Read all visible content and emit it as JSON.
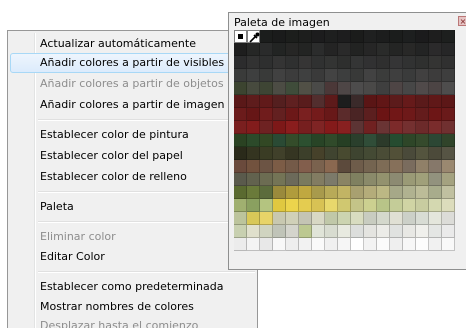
{
  "palette_window": {
    "title": "Paleta de imagen",
    "colors": [
      [
        "tool-pixel",
        "tool-eyedropper",
        "#1b1d1c",
        "#1a1b1b",
        "#1c1e1c",
        "#1d1e1d",
        "#1c1c1d",
        "#1e1f1f",
        "#1d1d1e",
        "#1b1c1b",
        "#1f2020",
        "#1c1d1d",
        "#1b1d1c",
        "#1d1f1f",
        "#1b1b1c",
        "#1e1e1e",
        "#1d1f1e"
      ],
      [
        "#1e1e1e",
        "#262726",
        "#2a2b2b",
        "#222423",
        "#262625",
        "#232423",
        "#2b2c2c",
        "#242424",
        "#2a2a2a",
        "#222322",
        "#262626",
        "#2a2b2a",
        "#242524",
        "#282827",
        "#232424",
        "#2b2a2b",
        "#262627"
      ],
      [
        "#2c2c2d",
        "#323232",
        "#2e2f2f",
        "#343434",
        "#2f3030",
        "#363535",
        "#303131",
        "#333433",
        "#2e2f2e",
        "#343535",
        "#313132",
        "#2f2f2f",
        "#353536",
        "#313232",
        "#2f302f",
        "#343433",
        "#303030"
      ],
      [
        "#3a3b3a",
        "#3e3f3f",
        "#393a39",
        "#414141",
        "#3c3c3c",
        "#3f4040",
        "#3a3a3a",
        "#434343",
        "#3d3e3e",
        "#383938",
        "#424242",
        "#3b3c3b",
        "#3f3f3f",
        "#3a3b3b",
        "#414040",
        "#3d3c3c",
        "#3e3e3e"
      ],
      [
        "#3c4430",
        "#474a3e",
        "#3e4534",
        "#4c4c44",
        "#3f4c3a",
        "#515046",
        "#4a4a48",
        "#4b3838",
        "#4e4646",
        "#4d4c4c",
        "#4a4948",
        "#3f3f3f",
        "#4e4545",
        "#474747",
        "#504a4a",
        "#4c4444",
        "#4e4d4d"
      ],
      [
        "#5a1818",
        "#5e1c1c",
        "#611a1a",
        "#541f1f",
        "#5f2020",
        "#591c1c",
        "#522e2e",
        "#5d1a1a",
        "#1d1d1d",
        "#3a2a2a",
        "#5a1515",
        "#611616",
        "#5c1b1b",
        "#661a1a",
        "#5a1a1a",
        "#601818",
        "#5c1717"
      ],
      [
        "#6b1b1b",
        "#661616",
        "#701c1c",
        "#632020",
        "#6c1818",
        "#7a2020",
        "#741b1b",
        "#681818",
        "#5b2b2b",
        "#4a2424",
        "#5c1f1f",
        "#6b1414",
        "#711717",
        "#6e1919",
        "#641c1c",
        "#6d1616",
        "#6a1a1a"
      ],
      [
        "#7a1f1f",
        "#821c1c",
        "#6e2222",
        "#7d1818",
        "#8a1d1d",
        "#761f1f",
        "#7f2424",
        "#841a1a",
        "#882020",
        "#5c3434",
        "#702121",
        "#6a3434",
        "#7c2a2a",
        "#743030",
        "#6c2a2a",
        "#7a2c2c",
        "#703030"
      ],
      [
        "#2a4222",
        "#2c4a2a",
        "#324824",
        "#2a4a34",
        "#344c2a",
        "#2c5030",
        "#284426",
        "#304a2a",
        "#263f24",
        "#2a3f2c",
        "#304d38",
        "#2c3a2a",
        "#264c30",
        "#2e4628",
        "#354a2c",
        "#2c4734",
        "#30442a"
      ],
      [
        "#2a2a1a",
        "#343420",
        "#3a3c24",
        "#40402a",
        "#353522",
        "#3c3f2a",
        "#46412a",
        "#404430",
        "#484a30",
        "#3e4430",
        "#444a34",
        "#4a4c36",
        "#525038",
        "#4a4a3a",
        "#54543e",
        "#4c4a3a",
        "#565444"
      ],
      [
        "#6a4a3c",
        "#72523e",
        "#6c5444",
        "#7c5c46",
        "#745a48",
        "#825e4c",
        "#7a624e",
        "#8a6850",
        "#5c4a3c",
        "#6e5c4a",
        "#746450",
        "#7e6c56",
        "#86705a",
        "#7a6c5e",
        "#908068",
        "#86786a",
        "#9a8870"
      ],
      [
        "#5a5a4c",
        "#62624e",
        "#6c6c52",
        "#747456",
        "#6c6a5a",
        "#7a7a5e",
        "#827c62",
        "#7c7a6a",
        "#8a8464",
        "#7f8060",
        "#8a8a6a",
        "#93926e",
        "#8c8a72",
        "#9a9a76",
        "#a0a07a",
        "#92927e",
        "#a4a280"
      ],
      [
        "#5a6a30",
        "#6a7a3a",
        "#5c6c3c",
        "#9a8a3c",
        "#b09c3c",
        "#c0a840",
        "#a89a4c",
        "#b8aa58",
        "#c2b464",
        "#a8a070",
        "#b4ac7a",
        "#bcb884",
        "#a6a888",
        "#b0b290",
        "#bcbc98",
        "#a8ac8c",
        "#c0c0a0"
      ],
      [
        "#a0b070",
        "#8aa060",
        "#b4c480",
        "#e0c840",
        "#ecd44c",
        "#e4cc50",
        "#d8c254",
        "#e8d86c",
        "#d0c870",
        "#c4c488",
        "#ccd090",
        "#b8c488",
        "#c4cc98",
        "#d0d4a4",
        "#c8cca0",
        "#d4d8b0",
        "#dcdcbc"
      ],
      [
        "#bcc49c",
        "#d8c858",
        "#e8d468",
        "#c8c8b0",
        "#d0d0b8",
        "#c4c4b4",
        "#d8d8c4",
        "#c0c8a8",
        "#ccd4b0",
        "#d8dcc0",
        "#c8ccc0",
        "#d4d8cc",
        "#e0e0d4",
        "#ccd0c8",
        "#d8dcd4",
        "#e4e6dc",
        "#dcdcd8"
      ],
      [
        "#c8d0b0",
        "#e0e0cc",
        "#d0d4c0",
        "#c0c4b8",
        "#d4d4cc",
        "#bcc890",
        "#e0e4d8",
        "#d8dcd0",
        "#e8eae0",
        "#dcdedc",
        "#e4e4e0",
        "#ecece8",
        "#e0e2e0",
        "#e8e8e4",
        "#f0f0ec",
        "#e4e6e4",
        "#eaeaea"
      ],
      [
        "#ececec",
        "#f4f4f4",
        "#e8e8e8",
        "#f8f8f8",
        "#eeeeee",
        "#f2f2f2",
        "#fafafa",
        "#f0f0f0",
        "#f6f6f6",
        "#ffffff",
        "#f3f3f3",
        "#fbfbfb",
        "#efefef",
        "#f7f7f7",
        "#fdfdfd",
        "#f1f1f1",
        "#f9f9f9"
      ]
    ]
  },
  "context_menu": {
    "items": [
      {
        "label": "Actualizar automáticamente",
        "disabled": false
      },
      {
        "label": "Añadir colores a partir de visibles",
        "disabled": false,
        "hover": true
      },
      {
        "label": "Añadir colores a partir de objetos",
        "disabled": true
      },
      {
        "label": "Añadir colores a partir de imagen",
        "disabled": false
      },
      {
        "label": "Establecer color de pintura",
        "disabled": false
      },
      {
        "label": "Establecer color del papel",
        "disabled": false
      },
      {
        "label": "Establecer color de relleno",
        "disabled": false
      },
      {
        "label": "Paleta",
        "disabled": false
      },
      {
        "label": "Eliminar color",
        "disabled": true
      },
      {
        "label": "Editar Color",
        "disabled": false
      },
      {
        "label": "Establecer como predeterminada",
        "disabled": false
      },
      {
        "label": "Mostrar nombres de colores",
        "disabled": false
      },
      {
        "label": "Desplazar hasta el comienzo",
        "disabled": true
      }
    ]
  }
}
